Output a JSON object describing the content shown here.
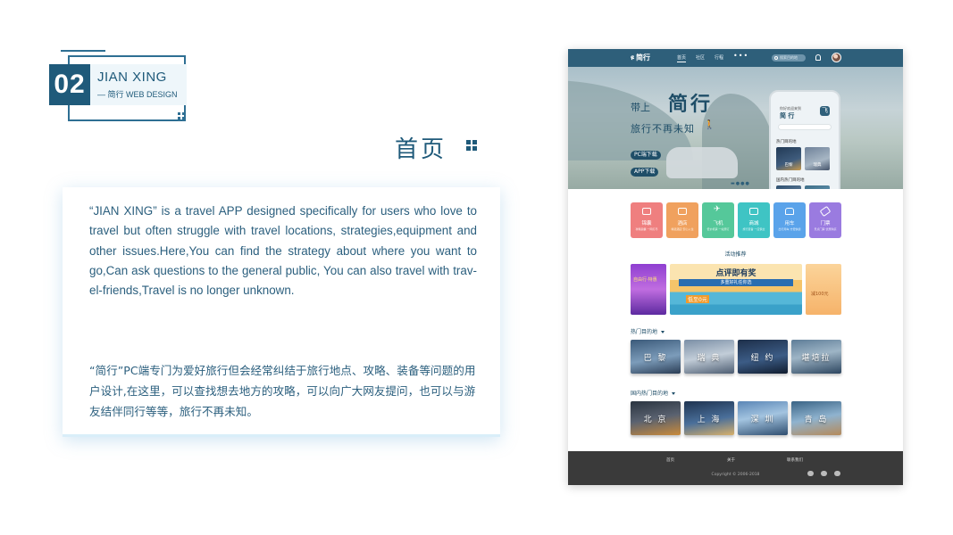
{
  "badge": {
    "number": "02",
    "title": "JIAN XING",
    "subtitle": "— 简行 WEB DESIGN"
  },
  "page_heading": "首页",
  "description": {
    "english": "“JIAN XING” is a travel APP designed specifically for users who love to travel but often struggle with travel locations, strategies,equipment and other issues.Here,You can find the strategy about where you want to go,Can ask questions to the general public, You can also travel with trav- el-friends,Travel is no longer unknown.",
    "chinese": "“简行”PC端专门为爱好旅行但会经常纠结于旅行地点、攻略、装备等问题的用户设计,在这里，可以查找想去地方的攻略，可以向广大网友提问，也可以与游友结伴同行等等，旅行不再未知。"
  },
  "mockup": {
    "nav": {
      "logo": "简行",
      "items": [
        "首页",
        "社区",
        "行程"
      ],
      "more": "•••",
      "search_placeholder": "搜索目的地"
    },
    "hero": {
      "line1": "带上",
      "big": "简行",
      "line2": "旅行不再未知",
      "btn_pc": "PC端下载",
      "btn_app": "APP下载",
      "phone": {
        "small": "你好欢迎来到",
        "title": "简 行",
        "icon": "飞",
        "hot": "热门目的地",
        "domestic": "国内热门目的地",
        "img1": "巴黎",
        "img2": "瑞典"
      }
    },
    "categories": [
      {
        "name": "锦囊",
        "desc": "攻略锦囊 一网打尽",
        "color": "#ef7f7f"
      },
      {
        "name": "酒店",
        "desc": "精选酒店 安心入住",
        "color": "#f0a15e"
      },
      {
        "name": "飞机",
        "desc": "低价机票 一站预订",
        "color": "#55c89a"
      },
      {
        "name": "商城",
        "desc": "旅行装备 一应俱全",
        "color": "#3fc4c4"
      },
      {
        "name": "用车",
        "desc": "出行用车 方便快捷",
        "color": "#5aa3ea"
      },
      {
        "name": "门票",
        "desc": "景点门票 优惠购买",
        "color": "#9a7be0"
      }
    ],
    "activity_title": "活动推荐",
    "banner": {
      "left": "自由行·特惠",
      "main": "点评即有奖",
      "strip": "多重好礼任你选",
      "price": "低至0元",
      "right": "减100元"
    },
    "hot_title": "热门目的地",
    "hot": [
      "巴 黎",
      "瑞 典",
      "纽 约",
      "堪培拉"
    ],
    "domestic_title": "国内热门目的地",
    "domestic": [
      "北 京",
      "上 海",
      "深 圳",
      "青 岛"
    ],
    "footer": {
      "links": [
        "首页",
        "关于",
        "联系我们"
      ],
      "copyright": "Copyright © 2006-2018"
    }
  }
}
